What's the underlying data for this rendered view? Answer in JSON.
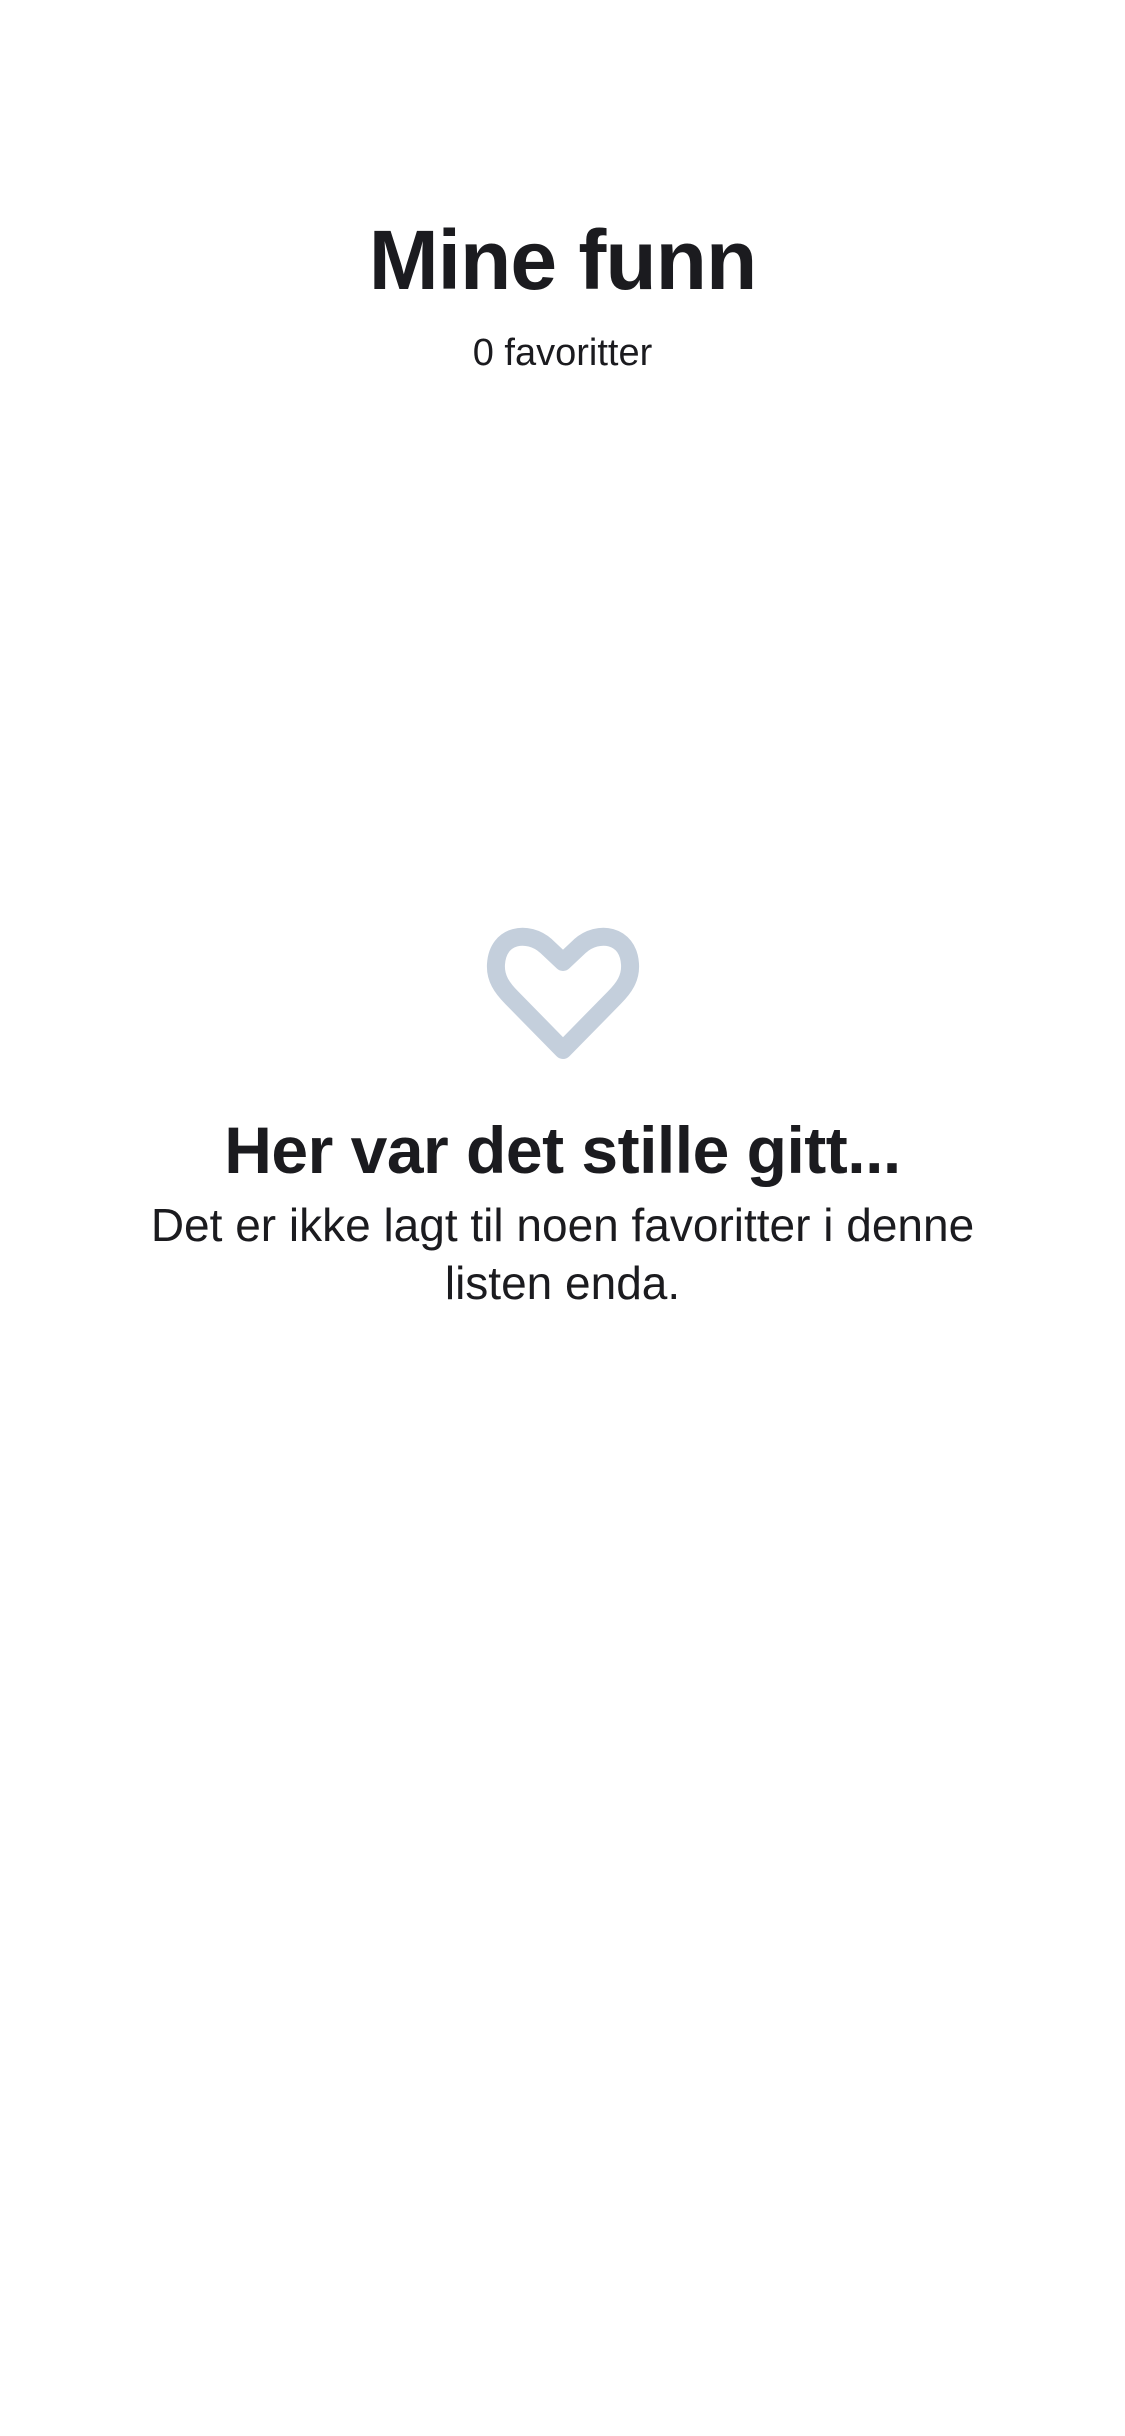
{
  "header": {
    "title": "Mine funn",
    "subtitle": "0 favoritter"
  },
  "empty_state": {
    "icon": "heart-outline-icon",
    "icon_color": "#c4cfdc",
    "title": "Her var det stille gitt...",
    "message": "Det er ikke lagt til noen favoritter i denne listen enda."
  },
  "colors": {
    "background": "#ffffff",
    "text": "#1b1b1f"
  }
}
